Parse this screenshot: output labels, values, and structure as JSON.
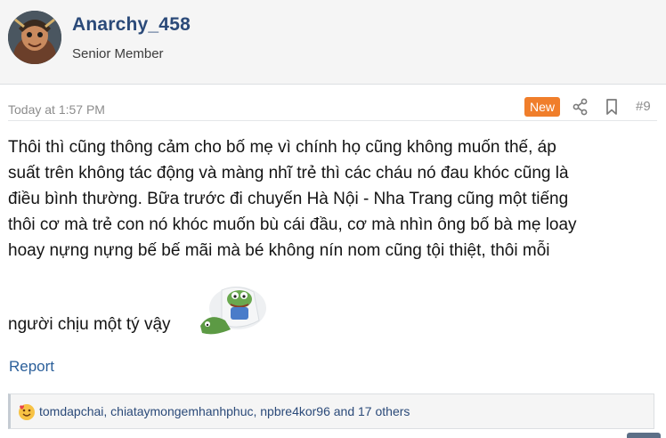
{
  "user": {
    "name": "Anarchy_458",
    "title": "Senior Member",
    "avatar_icon": "avatar-image"
  },
  "post": {
    "timestamp": "Today at 1:57 PM",
    "badge": "New",
    "number": "#9",
    "body_lines": [
      "Thôi thì cũng thông cảm cho bố mẹ vì chính họ cũng không muốn thế, áp",
      "suất trên không tác động và màng nhĩ trẻ thì các cháu nó đau khóc cũng là",
      "điều bình thường. Bữa trước đi chuyến Hà Nội - Nha Trang cũng một tiếng",
      "thôi cơ mà trẻ con nó khóc muốn bù cái đầu, cơ mà nhìn ông bố bà mẹ loay",
      "hoay nựng nựng bế bế mãi mà bé không nín nom cũng tội thiệt, thôi mỗi"
    ],
    "last_line": "người chịu một tý vậy",
    "sticker_icon": "pepe-sticker",
    "report_label": "Report"
  },
  "reactions": {
    "icon": "love-reaction-icon",
    "text": "tomdapchai, chiataymongemhanhphuc, npbre4kor96 and 17 others"
  },
  "colors": {
    "username": "#2b4a79",
    "badge": "#f07e2b",
    "link": "#2b5f9a"
  }
}
